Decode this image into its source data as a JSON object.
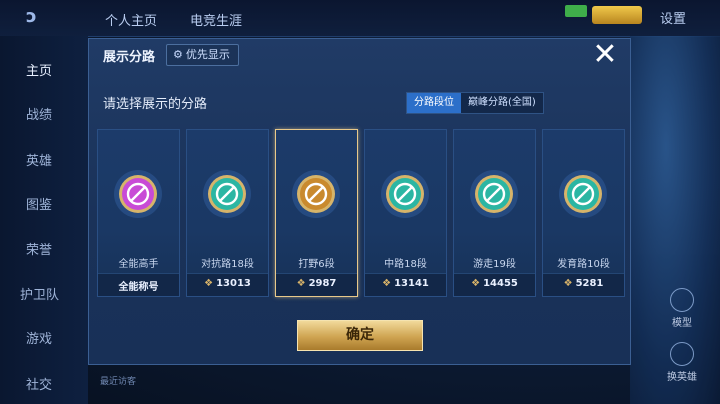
{
  "topbar": {
    "tabs": [
      "个人主页",
      "电竞生涯"
    ],
    "settings": "设置"
  },
  "sidebar": {
    "items": [
      {
        "label": "主页",
        "active": true
      },
      {
        "label": "战绩"
      },
      {
        "label": "英雄"
      },
      {
        "label": "图鉴"
      },
      {
        "label": "荣誉"
      },
      {
        "label": "护卫队"
      },
      {
        "label": "游戏"
      },
      {
        "label": "社交"
      }
    ]
  },
  "right_panel": {
    "model": "模型",
    "swap_hero": "换英雄"
  },
  "dialog": {
    "title": "展示分路",
    "priority_button": "优先显示",
    "prompt": "请选择展示的分路",
    "toggle": [
      {
        "label": "分路段位",
        "active": true
      },
      {
        "label": "巅峰分路(全国)",
        "active": false
      }
    ],
    "cards": [
      {
        "name": "全能高手",
        "value": "全能称号",
        "badge_icon": "all-round-badge-icon",
        "color": "#c84bd6",
        "selected": false,
        "has_tri": false
      },
      {
        "name": "对抗路18段",
        "value": "13013",
        "badge_icon": "clash-lane-badge-icon",
        "color": "#2bb6a3",
        "selected": false,
        "has_tri": true
      },
      {
        "name": "打野6段",
        "value": "2987",
        "badge_icon": "jungle-badge-icon",
        "color": "#c98a2e",
        "selected": true,
        "has_tri": true
      },
      {
        "name": "中路18段",
        "value": "13141",
        "badge_icon": "mid-lane-badge-icon",
        "color": "#2bb6a3",
        "selected": false,
        "has_tri": true
      },
      {
        "name": "游走19段",
        "value": "14455",
        "badge_icon": "roam-badge-icon",
        "color": "#2bb6a3",
        "selected": false,
        "has_tri": true
      },
      {
        "name": "发育路10段",
        "value": "5281",
        "badge_icon": "farm-lane-badge-icon",
        "color": "#2bb6a3",
        "selected": false,
        "has_tri": true
      }
    ],
    "confirm": "确定"
  },
  "visitors": "最近访客"
}
